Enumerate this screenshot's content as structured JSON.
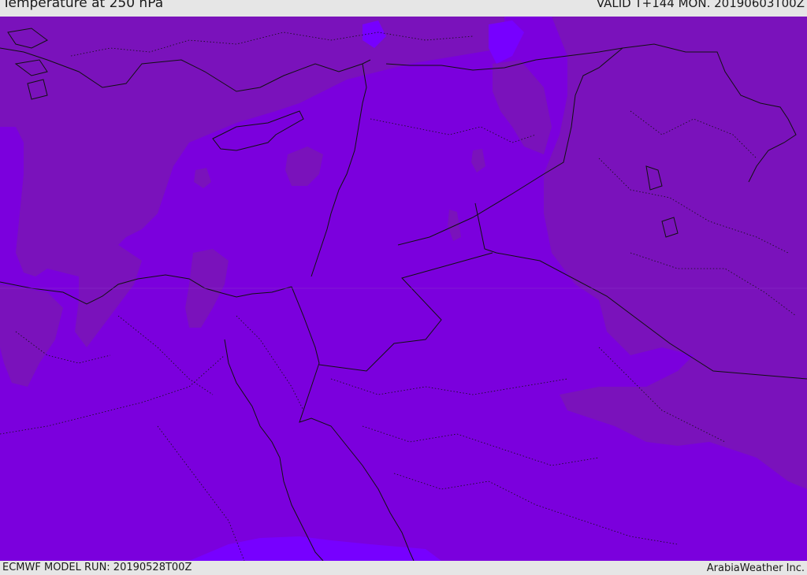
{
  "header": {
    "title": "Temperature at 250 hPa",
    "valid": "VALID T+144 MON. 20190603T00Z"
  },
  "footer": {
    "model_run": "ECMWF MODEL RUN: 20190528T00Z",
    "credit": "ArabiaWeather Inc."
  },
  "colors": {
    "warm_shade": "#7a12bb",
    "base_shade": "#7b00dd",
    "cold_shade": "#7700ff",
    "border_line": "#111111"
  }
}
